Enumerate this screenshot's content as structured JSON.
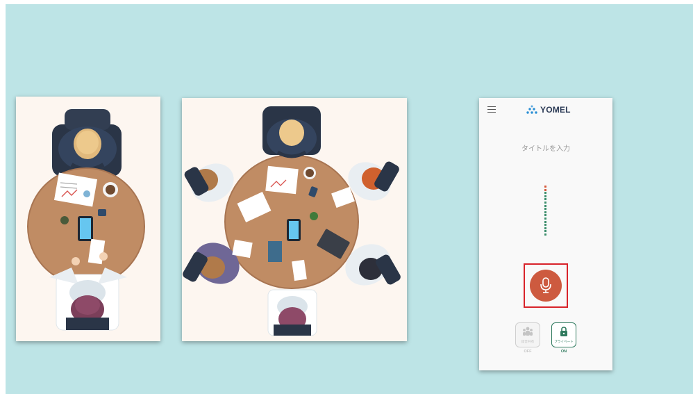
{
  "app": {
    "brand": "YOMEL",
    "title_placeholder": "タイトルを入力",
    "share_toggle": {
      "label": "録音共有",
      "state": "OFF",
      "icon": "people-icon"
    },
    "private_toggle": {
      "label": "プライベート",
      "state": "ON",
      "icon": "lock-icon"
    },
    "record_button_icon": "microphone-icon"
  },
  "audio_level": {
    "total_dots": 16,
    "warning_dots": 2
  },
  "colors": {
    "slide_background": "#bde4e6",
    "record_button": "#cd5a3f",
    "highlight_border": "#d8232a",
    "private_green": "#2f7a5e",
    "level_green": "#3d8f6d",
    "level_red": "#d55a3c",
    "table_wood": "#c08c64"
  },
  "illustrations": [
    {
      "name": "two-person-meeting-illustration",
      "people": 2
    },
    {
      "name": "six-person-meeting-illustration",
      "people": 6
    }
  ]
}
